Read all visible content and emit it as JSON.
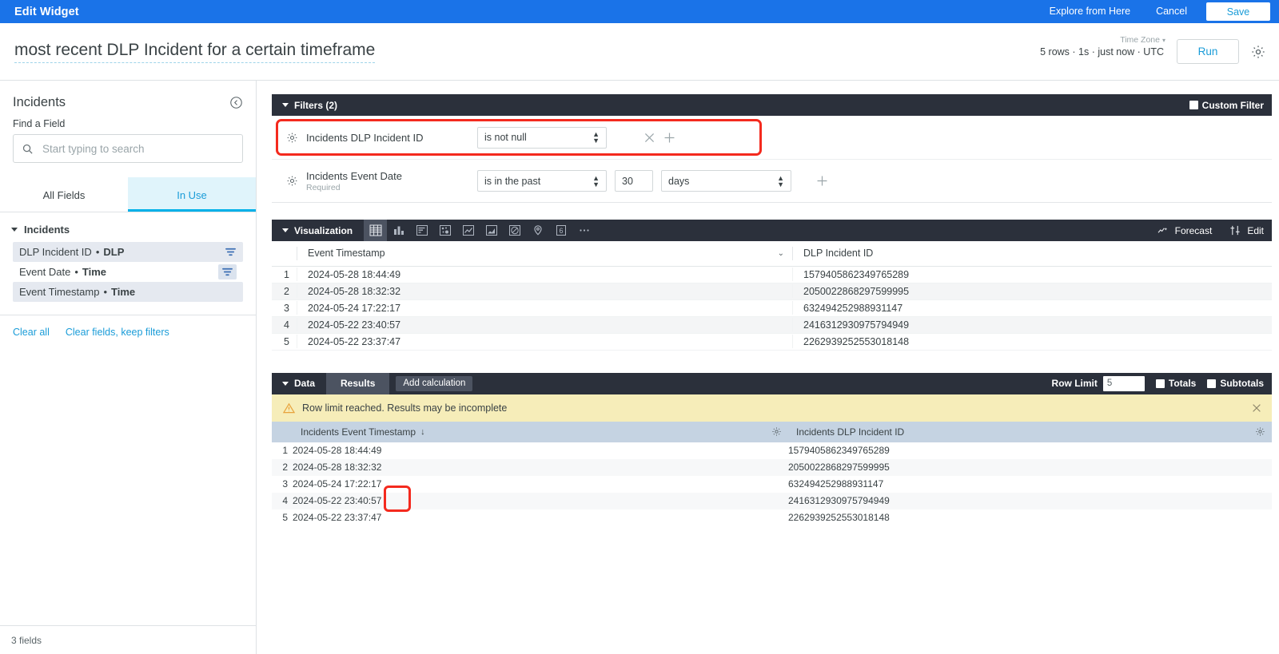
{
  "topbar": {
    "title": "Edit Widget",
    "explore_label": "Explore from Here",
    "cancel_label": "Cancel",
    "save_label": "Save"
  },
  "title_row": {
    "widget_title": "most recent DLP Incident for a certain timeframe",
    "timezone_label": "Time Zone",
    "meta": "5 rows · 1s · just now · UTC",
    "run_label": "Run"
  },
  "sidebar": {
    "title": "Incidents",
    "find_a_field_label": "Find a Field",
    "search_placeholder": "Start typing to search",
    "search_value": "",
    "tabs": [
      {
        "label": "All Fields",
        "active": false
      },
      {
        "label": "In Use",
        "active": true
      }
    ],
    "group_label": "Incidents",
    "fields": [
      {
        "name": "DLP Incident ID",
        "type": "DLP",
        "selected": true,
        "filter_icon": true,
        "filter_boxed": false
      },
      {
        "name": "Event Date",
        "type": "Time",
        "selected": false,
        "filter_icon": true,
        "filter_boxed": true
      },
      {
        "name": "Event Timestamp",
        "type": "Time",
        "selected": true,
        "filter_icon": false,
        "filter_boxed": false
      }
    ],
    "clear_all_label": "Clear all",
    "clear_fields_label": "Clear fields, keep filters",
    "footer_status": "3 fields"
  },
  "filters": {
    "header_label": "Filters (2)",
    "custom_filter_label": "Custom Filter",
    "custom_filter_checked": false,
    "rows": [
      {
        "field": "Incidents DLP Incident ID",
        "required": "",
        "operator": "is not null",
        "value": "",
        "unit": "",
        "has_remove": true,
        "has_add": true,
        "highlighted": true
      },
      {
        "field": "Incidents Event Date",
        "required": "Required",
        "operator": "is in the past",
        "value": "30",
        "unit": "days",
        "has_remove": false,
        "has_add": true,
        "highlighted": false
      }
    ]
  },
  "visualization": {
    "header_label": "Visualization",
    "icons": [
      {
        "name": "table-viz-icon",
        "active": true
      },
      {
        "name": "column-chart-icon",
        "active": false
      },
      {
        "name": "bar-chart-icon",
        "active": false
      },
      {
        "name": "scatter-plot-icon",
        "active": false
      },
      {
        "name": "line-chart-icon",
        "active": false
      },
      {
        "name": "area-chart-icon",
        "active": false
      },
      {
        "name": "pie-chart-icon",
        "active": false
      },
      {
        "name": "map-pin-icon",
        "active": false
      },
      {
        "name": "single-value-icon",
        "active": false,
        "text": "6"
      },
      {
        "name": "more-options-icon",
        "active": false
      }
    ],
    "forecast_label": "Forecast",
    "edit_label": "Edit",
    "table": {
      "columns": [
        "Event Timestamp",
        "DLP Incident ID"
      ],
      "rows": [
        {
          "index": "1",
          "timestamp": "2024-05-28 18:44:49",
          "incident_id": "1579405862349765289"
        },
        {
          "index": "2",
          "timestamp": "2024-05-28 18:32:32",
          "incident_id": "2050022868297599995"
        },
        {
          "index": "3",
          "timestamp": "2024-05-24 17:22:17",
          "incident_id": "632494252988931147"
        },
        {
          "index": "4",
          "timestamp": "2024-05-22 23:40:57",
          "incident_id": "2416312930975794949"
        },
        {
          "index": "5",
          "timestamp": "2024-05-22 23:37:47",
          "incident_id": "2262939252553018148"
        }
      ]
    }
  },
  "data_section": {
    "header_label": "Data",
    "tabs": [
      {
        "label": "Results",
        "active": true
      }
    ],
    "add_calculation_label": "Add calculation",
    "row_limit_label": "Row Limit",
    "row_limit_value": "5",
    "totals_label": "Totals",
    "totals_checked": false,
    "subtotals_label": "Subtotals",
    "subtotals_checked": false,
    "warning_text": "Row limit reached. Results may be incomplete",
    "table": {
      "columns": [
        "Incidents Event Timestamp",
        "Incidents DLP Incident ID"
      ],
      "sort_indicator": "↓",
      "rows": [
        {
          "index": "1",
          "timestamp": "2024-05-28 18:44:49",
          "incident_id": "1579405862349765289"
        },
        {
          "index": "2",
          "timestamp": "2024-05-28 18:32:32",
          "incident_id": "2050022868297599995"
        },
        {
          "index": "3",
          "timestamp": "2024-05-24 17:22:17",
          "incident_id": "632494252988931147"
        },
        {
          "index": "4",
          "timestamp": "2024-05-22 23:40:57",
          "incident_id": "2416312930975794949"
        },
        {
          "index": "5",
          "timestamp": "2024-05-22 23:37:47",
          "incident_id": "2262939252553018148"
        }
      ]
    }
  },
  "colors": {
    "brand_blue": "#1a73e8",
    "accent_cyan": "#1a9cd8",
    "dark_bar": "#2b303b",
    "highlight_red": "#f42a1e",
    "warning_bg": "#f6edb9",
    "result_header": "#c5d3e2"
  }
}
